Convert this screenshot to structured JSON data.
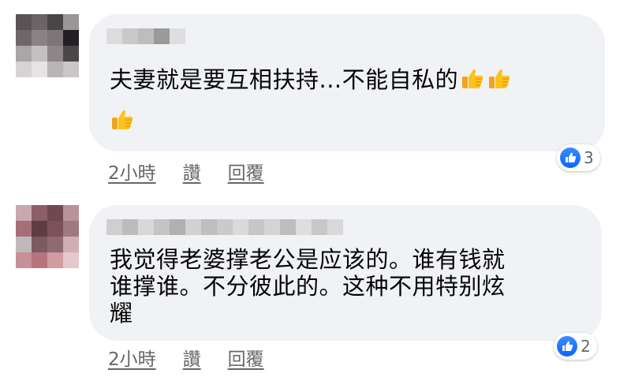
{
  "comments": [
    {
      "text_lines": [
        "夫妻就是要互相扶持...不能自私的"
      ],
      "thumbs_inline": 2,
      "thumbs_next_line": 1,
      "time": "2小時",
      "like_label": "讚",
      "reply_label": "回覆",
      "reaction_count": "3"
    },
    {
      "text_lines": [
        "我觉得老婆撑老公是应该的。谁有钱就",
        "谁撑谁。不分彼此的。这种不用特别炫",
        "耀"
      ],
      "time": "2小時",
      "like_label": "讚",
      "reply_label": "回覆",
      "reaction_count": "2"
    }
  ],
  "colors": {
    "bubble": "#f0f2f5",
    "meta_text": "#65676b",
    "like_blue": "#0866ff"
  },
  "icons": [
    "thumbs-up-emoji",
    "like-reaction-icon"
  ]
}
